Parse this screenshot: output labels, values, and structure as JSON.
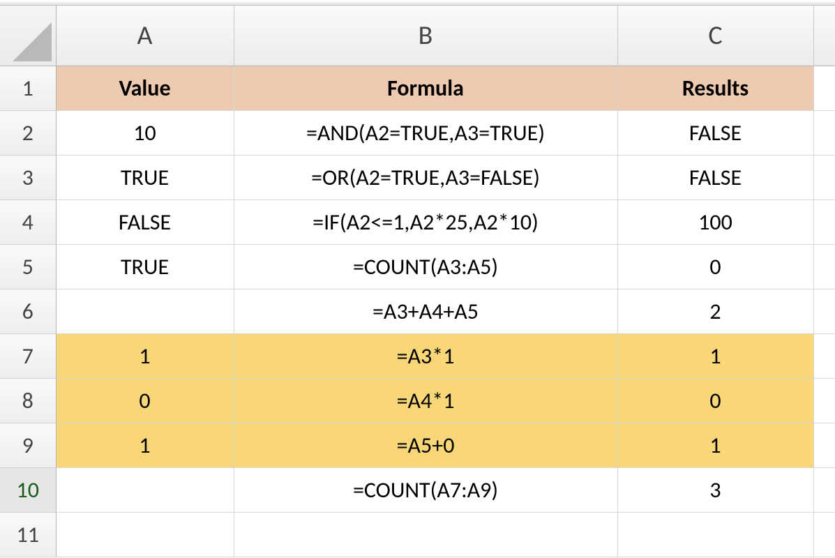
{
  "columns": {
    "A": "A",
    "B": "B",
    "C": "C"
  },
  "rowNumbers": [
    "1",
    "2",
    "3",
    "4",
    "5",
    "6",
    "7",
    "8",
    "9",
    "10",
    "11"
  ],
  "headerRow": {
    "A": "Value",
    "B": "Formula",
    "C": "Results"
  },
  "rows": [
    {
      "A": "10",
      "B": "=AND(A2=TRUE,A3=TRUE)",
      "C": "FALSE",
      "hl": false
    },
    {
      "A": "TRUE",
      "B": "=OR(A2=TRUE,A3=FALSE)",
      "C": "FALSE",
      "hl": false
    },
    {
      "A": "FALSE",
      "B": "=IF(A2<=1,A2*25,A2*10)",
      "C": "100",
      "hl": false
    },
    {
      "A": "TRUE",
      "B": "=COUNT(A3:A5)",
      "C": "0",
      "hl": false
    },
    {
      "A": "",
      "B": "=A3+A4+A5",
      "C": "2",
      "hl": false
    },
    {
      "A": "1",
      "B": "=A3*1",
      "C": "1",
      "hl": true
    },
    {
      "A": "0",
      "B": "=A4*1",
      "C": "0",
      "hl": true
    },
    {
      "A": "1",
      "B": "=A5+0",
      "C": "1",
      "hl": true
    },
    {
      "A": "",
      "B": "=COUNT(A7:A9)",
      "C": "3",
      "hl": false
    },
    {
      "A": "",
      "B": "",
      "C": "",
      "hl": false
    }
  ],
  "selectedRowIndex": 9
}
